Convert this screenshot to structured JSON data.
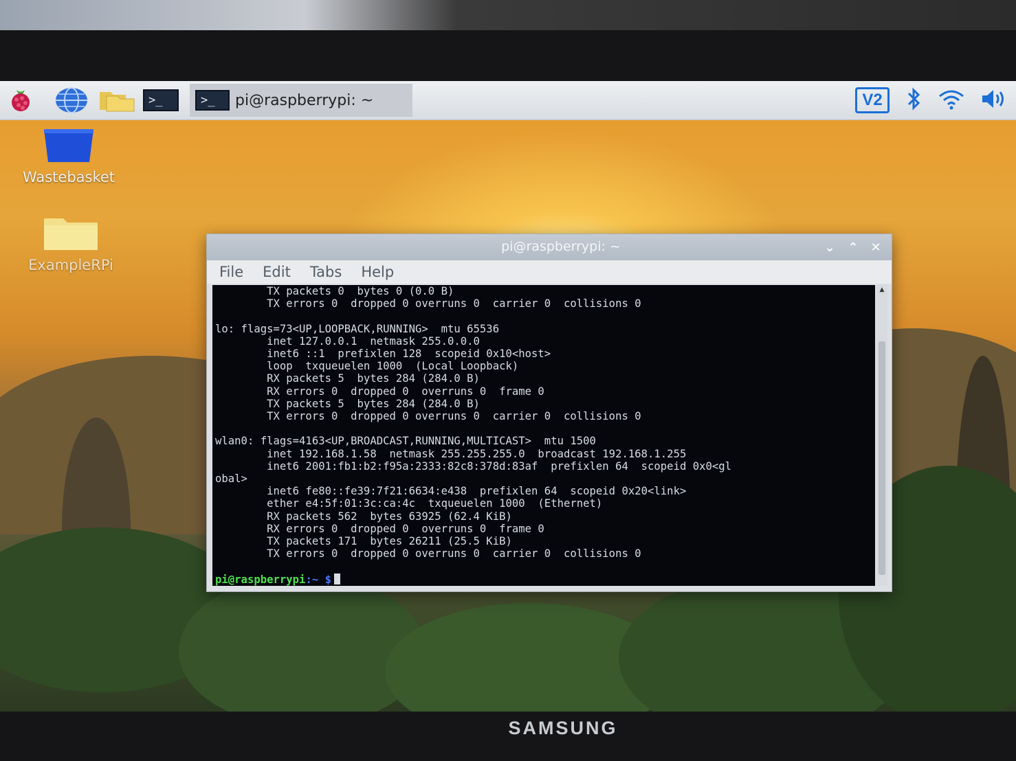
{
  "taskbar": {
    "task_label": "pi@raspberrypi: ~",
    "terminal_glyph": ">_",
    "tray": {
      "vnc_label": "V2",
      "icons": [
        "bluetooth-icon",
        "wifi-icon",
        "volume-icon"
      ]
    }
  },
  "desktop": {
    "icons": [
      {
        "label": "Wastebasket",
        "icon": "trash-icon"
      },
      {
        "label": "ExampleRPi",
        "icon": "folder-icon"
      }
    ]
  },
  "window": {
    "title": "pi@raspberrypi: ~",
    "controls": {
      "minimize": "⌄",
      "maximize": "⌃",
      "close": "✕"
    },
    "menu": [
      "File",
      "Edit",
      "Tabs",
      "Help"
    ],
    "terminal_lines": [
      "        TX packets 0  bytes 0 (0.0 B)",
      "        TX errors 0  dropped 0 overruns 0  carrier 0  collisions 0",
      "",
      "lo: flags=73<UP,LOOPBACK,RUNNING>  mtu 65536",
      "        inet 127.0.0.1  netmask 255.0.0.0",
      "        inet6 ::1  prefixlen 128  scopeid 0x10<host>",
      "        loop  txqueuelen 1000  (Local Loopback)",
      "        RX packets 5  bytes 284 (284.0 B)",
      "        RX errors 0  dropped 0  overruns 0  frame 0",
      "        TX packets 5  bytes 284 (284.0 B)",
      "        TX errors 0  dropped 0 overruns 0  carrier 0  collisions 0",
      "",
      "wlan0: flags=4163<UP,BROADCAST,RUNNING,MULTICAST>  mtu 1500",
      "        inet 192.168.1.58  netmask 255.255.255.0  broadcast 192.168.1.255",
      "        inet6 2001:fb1:b2:f95a:2333:82c8:378d:83af  prefixlen 64  scopeid 0x0<gl",
      "obal>",
      "        inet6 fe80::fe39:7f21:6634:e438  prefixlen 64  scopeid 0x20<link>",
      "        ether e4:5f:01:3c:ca:4c  txqueuelen 1000  (Ethernet)",
      "        RX packets 562  bytes 63925 (62.4 KiB)",
      "        RX errors 0  dropped 0  overruns 0  frame 0",
      "        TX packets 171  bytes 26211 (25.5 KiB)",
      "        TX errors 0  dropped 0 overruns 0  carrier 0  collisions 0"
    ],
    "prompt": {
      "user_host": "pi@raspberrypi",
      "path": ":~ $"
    }
  },
  "monitor": {
    "brand": "SAMSUNG"
  },
  "colors": {
    "prompt_user": "#4ee04e",
    "prompt_path": "#4a78ff",
    "terminal_bg": "#05070d",
    "vnc_accent": "#1b6fd6"
  }
}
